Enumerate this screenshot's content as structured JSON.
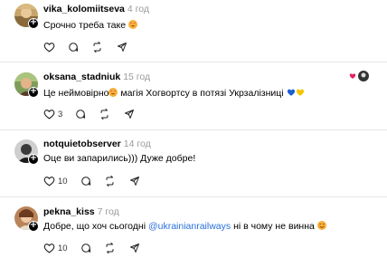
{
  "comments": [
    {
      "username": "vika_kolomiitseva",
      "time": "4 год",
      "text": "Срочно треба таке",
      "like_count": "",
      "reply_count": ""
    },
    {
      "username": "oksana_stadniuk",
      "time": "15 год",
      "text": "Це неймовірно",
      "text_after_emoji": " магія Хогвортсу в потязі Укрзалізниці ",
      "like_count": "3",
      "reply_count": ""
    },
    {
      "username": "notquietobserver",
      "time": "14 год",
      "text": "Оце ви запарились))) Дуже добре!",
      "like_count": "10",
      "reply_count": ""
    },
    {
      "username": "pekna_kiss",
      "time": "7 год",
      "text_before_mention": "Добре, що хоч сьогодні ",
      "mention": "@ukrainianrailways",
      "text_after_mention": " ні в чому не винна",
      "like_count": "10",
      "reply_count": ""
    }
  ],
  "icons": {
    "like": "heart-icon",
    "reply": "comment-icon",
    "repost": "repost-icon",
    "share": "share-icon",
    "follow_badge": "plus-icon",
    "emoji_heart_eyes": "heart-eyes-emoji",
    "emoji_smile": "smiling-emoji",
    "flag_blue": "blue-heart-emoji",
    "flag_yellow": "yellow-heart-emoji"
  },
  "colors": {
    "mention": "#2a6fdb",
    "time": "#9a9a9a",
    "heart_red": "#e0245e",
    "flag_blue": "#1b5fd6",
    "flag_yellow": "#f5c400"
  }
}
